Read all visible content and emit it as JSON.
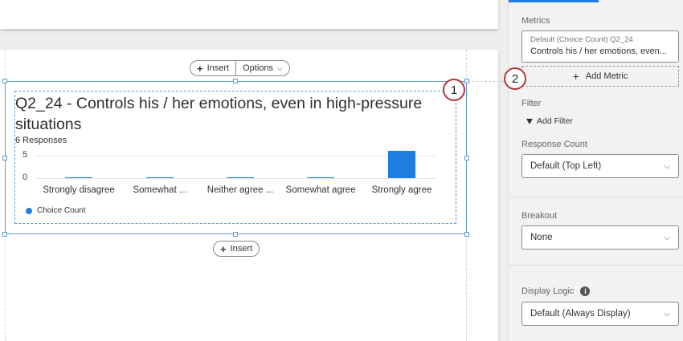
{
  "toolbar": {
    "insert_label": "Insert",
    "options_label": "Options"
  },
  "widget": {
    "title": "Q2_24 - Controls his / her emotions, even in high-pressure situations",
    "responses": "6 Responses",
    "insert_below_label": "Insert"
  },
  "chart_data": {
    "type": "bar",
    "categories": [
      "Strongly disagree",
      "Somewhat ...",
      "Neither agree ...",
      "Somewhat agree",
      "Strongly agree"
    ],
    "series": [
      {
        "name": "Choice Count",
        "values": [
          0,
          0,
          0,
          0,
          6
        ]
      }
    ],
    "y_ticks": [
      "5",
      "0"
    ],
    "ylim": [
      0,
      6
    ],
    "legend_position": "bottom-left",
    "color": "#1e7de0"
  },
  "callouts": {
    "one": "1",
    "two": "2"
  },
  "panel": {
    "metrics_label": "Metrics",
    "metric": {
      "subtitle": "Default (Choice Count) Q2_24",
      "name": "Controls his / her emotions, even..."
    },
    "add_metric_label": "Add Metric",
    "filter_label": "Filter",
    "add_filter_label": "Add Filter",
    "response_count_label": "Response Count",
    "response_count_value": "Default (Top Left)",
    "breakout_label": "Breakout",
    "breakout_value": "None",
    "display_logic_label": "Display Logic",
    "display_logic_value": "Default (Always Display)"
  },
  "icons": {
    "info": "i",
    "chevron": "chevron-down-icon",
    "plus": "plus-icon",
    "filter": "filter-icon"
  },
  "colors": {
    "accent": "#1e7de0",
    "callout": "#b0383a",
    "selection": "#5b9bd5"
  }
}
